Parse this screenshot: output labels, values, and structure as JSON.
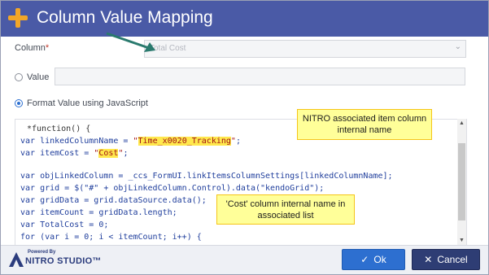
{
  "dialog": {
    "title": "Column Value Mapping",
    "accent_color": "#f2a628",
    "titlebar_color": "#4a5aa6"
  },
  "column_field": {
    "label": "Column",
    "required_marker": "*",
    "selected_value": "Total Cost",
    "chevron_icon": "chevron-down-icon"
  },
  "value_option": {
    "label": "Value",
    "checked": false
  },
  "format_option": {
    "label": "Format Value using JavaScript",
    "checked": true
  },
  "code": {
    "lines": [
      "*function() {",
      "var linkedColumnName = \"Time_x0020_Tracking\";",
      "var itemCost = \"Cost\";",
      "",
      "var objLinkedColumn = _ccs_FormUI.linkItemsColumnSettings[linkedColumnName];",
      "var grid = $(\"#\" + objLinkedColumn.Control).data(\"kendoGrid\");",
      "var gridData = grid.dataSource.data();",
      "var itemCount = gridData.length;",
      "var TotalCost = 0;",
      "for (var i = 0; i < itemCount; i++) {"
    ]
  },
  "callouts": {
    "linked_column": "NITRO associated item column internal name",
    "cost_column": "'Cost' column internal name in associated list"
  },
  "footer": {
    "powered_by": "Powered By",
    "brand": "NITRO STUDIO™",
    "ok_label": "Ok",
    "cancel_label": "Cancel",
    "ok_icon": "check-icon",
    "cancel_icon": "close-icon",
    "ok_color": "#2d6fd0",
    "cancel_color": "#2e3d74"
  }
}
